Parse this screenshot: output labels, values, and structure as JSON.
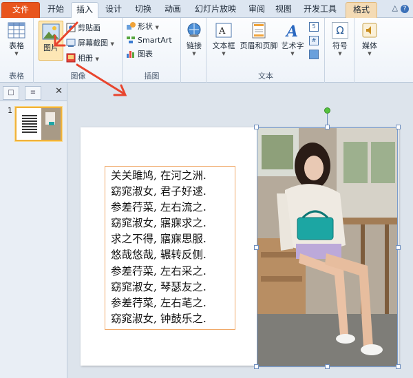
{
  "tabs": [
    {
      "label": "文件",
      "kind": "file"
    },
    {
      "label": "开始"
    },
    {
      "label": "插入",
      "kind": "active"
    },
    {
      "label": "设计"
    },
    {
      "label": "切换"
    },
    {
      "label": "动画"
    },
    {
      "label": "幻灯片放映"
    },
    {
      "label": "审阅"
    },
    {
      "label": "视图"
    },
    {
      "label": "开发工具"
    },
    {
      "label": "格式",
      "kind": "format"
    }
  ],
  "ribbon": {
    "tables": {
      "button": "表格",
      "group": "表格"
    },
    "images": {
      "picture": "图片",
      "clipart": "剪贴画",
      "screenshot": "屏幕截图",
      "album": "相册",
      "group": "图像"
    },
    "illustrations": {
      "shapes": "形状",
      "smartart": "SmartArt",
      "chart": "图表",
      "group": "插图"
    },
    "links": {
      "link": "链接"
    },
    "text": {
      "textbox": "文本框",
      "headerfooter": "页眉和页脚",
      "wordart": "艺术字",
      "group": "文本"
    },
    "symbols": {
      "symbol": "符号"
    },
    "media": {
      "media": "媒体"
    }
  },
  "slides_panel": {
    "slide_number": "1"
  },
  "slide": {
    "poem_lines": [
      "关关雎鸠, 在河之洲.",
      "窈窕淑女, 君子好逑.",
      "参差荇菜, 左右流之.",
      "窈窕淑女, 寤寐求之.",
      "求之不得, 寤寐思服.",
      "悠哉悠哉, 辗转反侧.",
      "参差荇菜, 左右采之.",
      "窈窕淑女, 琴瑟友之.",
      "参差荇菜, 左右芼之.",
      "窈窕淑女, 钟鼓乐之."
    ]
  },
  "colors": {
    "file_tab": "#e8551d",
    "arrow": "#e8452e",
    "selection": "#6f8fbf",
    "textbox_border": "#f0a868"
  }
}
